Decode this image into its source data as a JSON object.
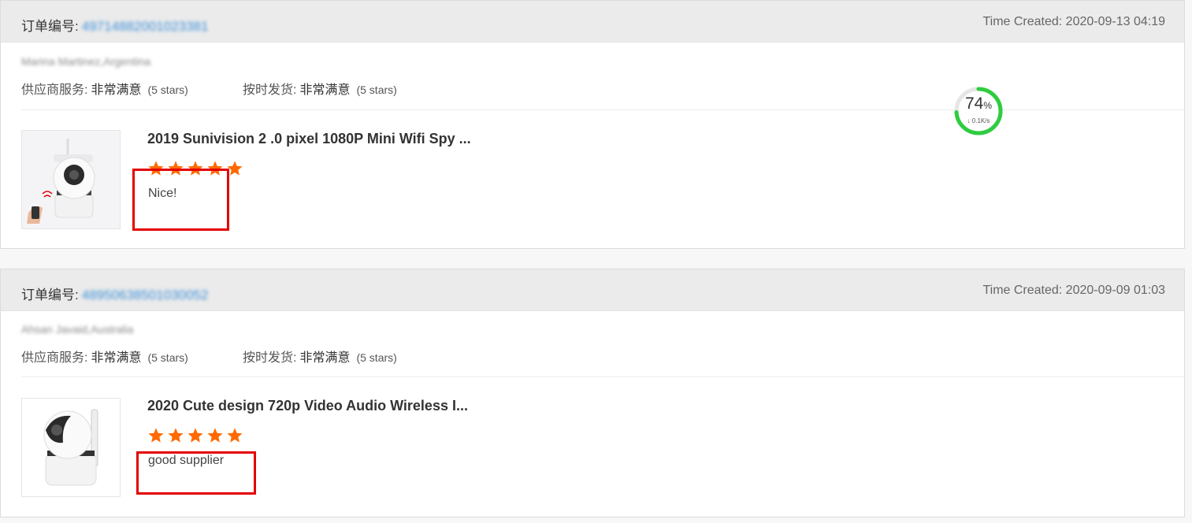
{
  "orders": [
    {
      "order_label": "订单编号:",
      "order_number": "49714882001023381",
      "time_created": "Time Created: 2020-09-13 04:19",
      "buyer_location": "Marina Martinez,Argentina",
      "supplier_service_label": "供应商服务:",
      "supplier_service_value": "非常满意",
      "supplier_service_stars": "(5 stars)",
      "on_time_label": "按时发货:",
      "on_time_value": "非常满意",
      "on_time_stars": "(5 stars)",
      "product_name": "2019 Sunivision 2 .0 pixel 1080P Mini Wifi Spy ...",
      "rating": 5,
      "comment": "Nice!"
    },
    {
      "order_label": "订单编号:",
      "order_number": "48950638501030052",
      "time_created": "Time Created: 2020-09-09 01:03",
      "buyer_location": "Ahsan Javaid,Australia",
      "supplier_service_label": "供应商服务:",
      "supplier_service_value": "非常满意",
      "supplier_service_stars": "(5 stars)",
      "on_time_label": "按时发货:",
      "on_time_value": "非常满意",
      "on_time_stars": "(5 stars)",
      "product_name": "2020 Cute design 720p Video Audio Wireless I...",
      "rating": 5,
      "comment": "good supplier"
    }
  ],
  "speed_widget": {
    "percent": "74",
    "percent_sign": "%",
    "rate": "↓ 0.1K/s",
    "progress": 0.74
  },
  "colors": {
    "link": "#3b8fd8",
    "star": "#ff6a00",
    "highlight_box": "#e40000",
    "gauge": "#2ecc40"
  }
}
